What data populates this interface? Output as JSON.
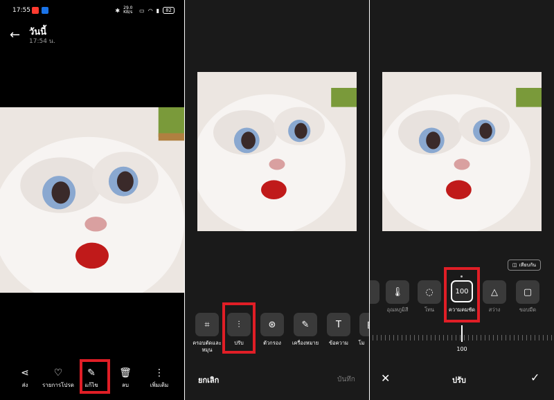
{
  "status_bar": {
    "time": "17:55",
    "net_speed": "29.0 KB/s",
    "battery": "82"
  },
  "viewer": {
    "title": "วันนี้",
    "subtitle": "17:54 น."
  },
  "viewer_toolbar": {
    "items": [
      {
        "label": "ส่ง",
        "icon": "share-icon"
      },
      {
        "label": "รายการโปรด",
        "icon": "heart-icon"
      },
      {
        "label": "แก้ไข",
        "icon": "edit-icon"
      },
      {
        "label": "ลบ",
        "icon": "trash-icon"
      },
      {
        "label": "เพิ่มเติม",
        "icon": "more-icon"
      }
    ]
  },
  "editor": {
    "tools": [
      {
        "label": "ครอบตัดและหมุน",
        "icon": "crop-icon"
      },
      {
        "label": "ปรับ",
        "icon": "adjust-icon"
      },
      {
        "label": "ตัวกรอง",
        "icon": "filter-icon"
      },
      {
        "label": "เครื่องหมาย",
        "icon": "markup-icon"
      },
      {
        "label": "ข้อความ",
        "icon": "text-icon"
      },
      {
        "label": "โม",
        "icon": "mosaic-icon"
      }
    ],
    "cancel_label": "ยกเลิก",
    "save_label": "บันทึก"
  },
  "adjust": {
    "compare_label": "เทียบกัน",
    "options": [
      {
        "label": "",
        "icon": "partial-chip-icon"
      },
      {
        "label": "อุณหภูมิสี",
        "icon": "thermometer-icon"
      },
      {
        "label": "โทน",
        "icon": "tone-icon"
      },
      {
        "label": "ความคมชัด",
        "icon": "sharpness-icon",
        "value": "100"
      },
      {
        "label": "สว่าง",
        "icon": "brightness-icon"
      },
      {
        "label": "ขอบมืด",
        "icon": "vignette-icon"
      }
    ],
    "slider_value": "100",
    "title": "ปรับ"
  },
  "colors": {
    "highlight": "#e01e26",
    "panel_bg": "#1a1a1a",
    "chip_bg": "#3a3a3a"
  }
}
